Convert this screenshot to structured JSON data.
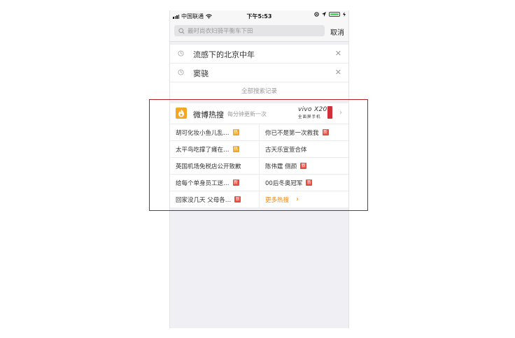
{
  "status_bar": {
    "carrier": "中国联通",
    "time": "下午5:53"
  },
  "search": {
    "placeholder": "最时尚衣妇骑平衡车下田",
    "cancel_label": "取消"
  },
  "history": {
    "items": [
      {
        "text": "流感下的北京中年"
      },
      {
        "text": "窦骁"
      }
    ],
    "all_label": "全部搜索记录"
  },
  "hot": {
    "title": "微博热搜",
    "subtitle": "每分钟更新一次",
    "ad": {
      "brand": "vivo X20",
      "tagline": "全面屏手机"
    },
    "rows": [
      {
        "left": {
          "text": "胡可化妆小鱼儿乱…",
          "badge": "热",
          "badge_type": "hot"
        },
        "right": {
          "text": "你已不是第一次救我",
          "badge": "新",
          "badge_type": "new"
        }
      },
      {
        "left": {
          "text": "太平鸟吃撑了瘫在…",
          "badge": "热",
          "badge_type": "hot"
        },
        "right": {
          "text": "古天乐宣萱合体",
          "badge": "",
          "badge_type": ""
        }
      },
      {
        "left": {
          "text": "英国机场免税店公开致歉",
          "badge": "",
          "badge_type": ""
        },
        "right": {
          "text": "陈伟霆 侧颜",
          "badge": "新",
          "badge_type": "new"
        }
      },
      {
        "left": {
          "text": "给每个单身员工送…",
          "badge": "新",
          "badge_type": "new"
        },
        "right": {
          "text": "00后冬奥冠军",
          "badge": "新",
          "badge_type": "new"
        }
      },
      {
        "left": {
          "text": "回家没几天 父母各…",
          "badge": "新",
          "badge_type": "new"
        },
        "right": {
          "text": "更多热搜",
          "badge": "",
          "badge_type": "more"
        }
      }
    ]
  },
  "colors": {
    "accent": "#ff8200",
    "highlight_border": "#b01e24",
    "hot_badge": "#f5a623",
    "new_badge": "#e74c3c"
  }
}
